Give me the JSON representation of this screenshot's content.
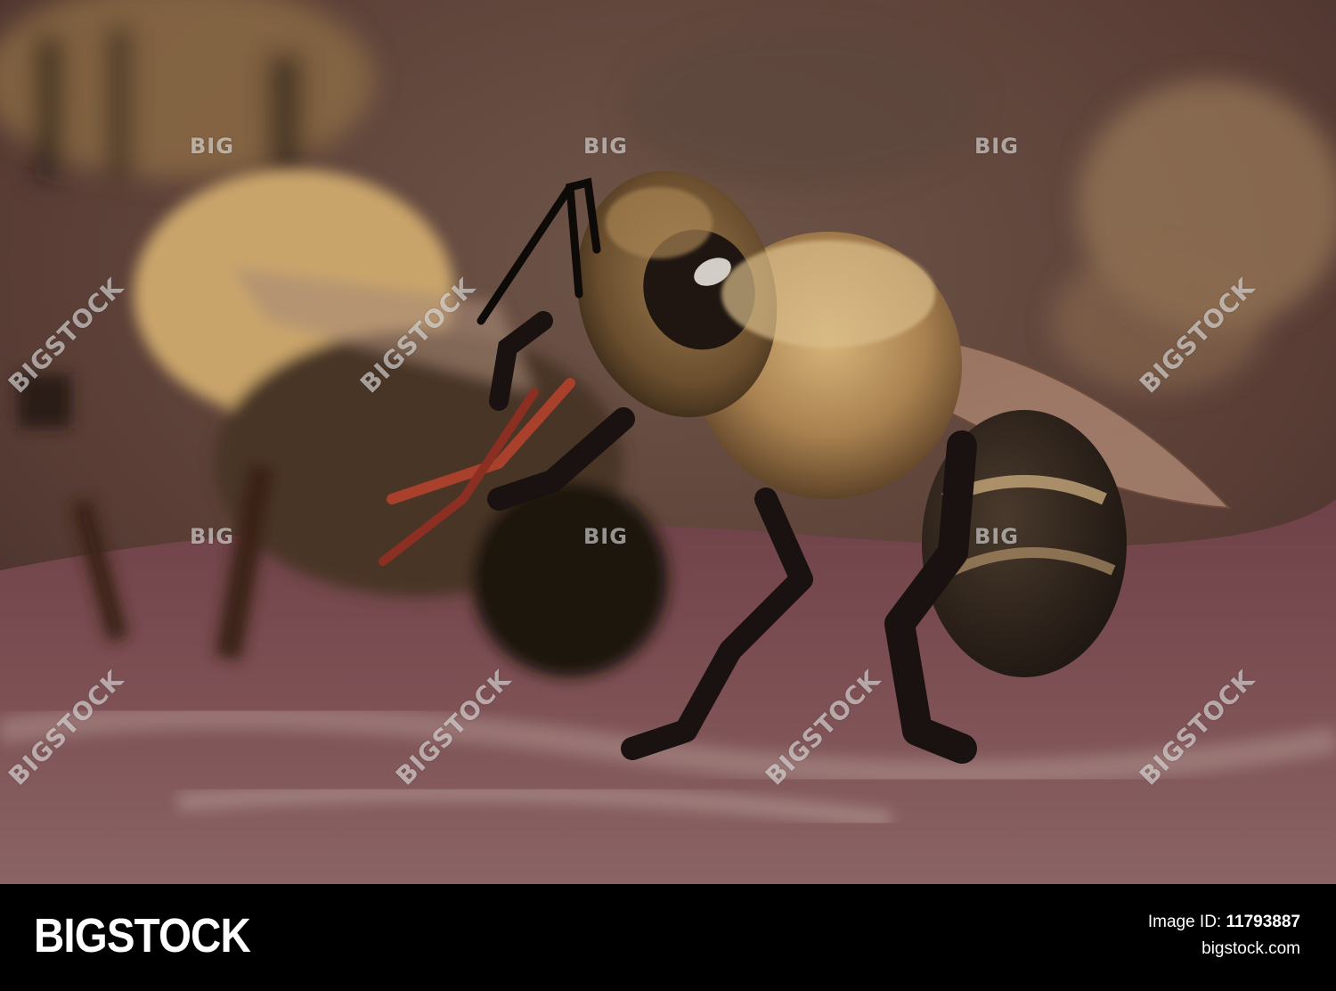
{
  "footer": {
    "brand": "BIGSTOCK",
    "image_id_label": "Image ID:",
    "image_id": "11793887",
    "site": "bigstock.com"
  },
  "watermarks": {
    "big": "BIG",
    "stock": "BIGSTOCK"
  },
  "colors": {
    "background_blur": "#6a4a3a",
    "surface": "#7a4f4f",
    "bee_fur": "#b08a55",
    "bee_dark": "#1c1410",
    "footer_bg": "#000000",
    "footer_text": "#ffffff"
  }
}
